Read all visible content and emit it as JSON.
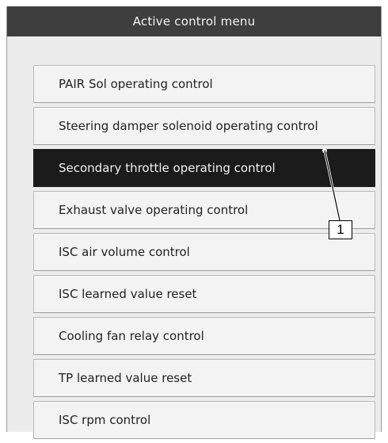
{
  "window": {
    "title": "Active control menu"
  },
  "menu": {
    "items": [
      {
        "label": "PAIR Sol operating control"
      },
      {
        "label": "Steering damper solenoid operating control"
      },
      {
        "label": "Secondary throttle operating control",
        "selected": true
      },
      {
        "label": "Exhaust valve operating control"
      },
      {
        "label": "ISC air volume control"
      },
      {
        "label": "ISC learned value reset"
      },
      {
        "label": "Cooling fan relay control"
      },
      {
        "label": "TP learned value reset"
      },
      {
        "label": "ISC rpm control"
      }
    ]
  },
  "callout": {
    "number": "1"
  },
  "colors": {
    "title_bar_bg": "#3e3e3e",
    "panel_bg": "#ececec",
    "item_bg": "#f3f3f3",
    "selected_bg": "#1b1b1b"
  }
}
